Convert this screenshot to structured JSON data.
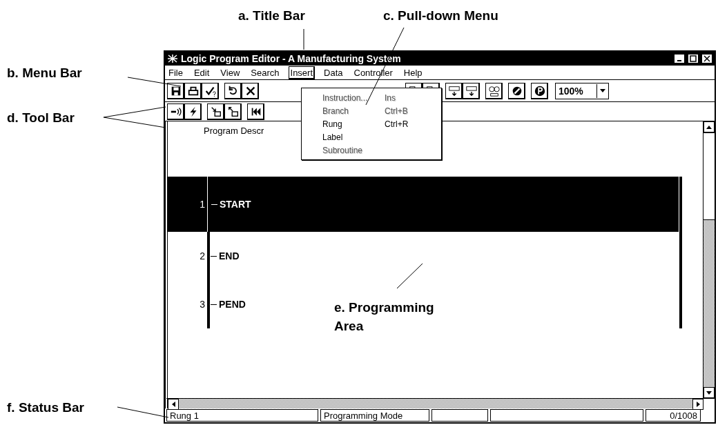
{
  "annotations": [
    {
      "text": "a. Title Bar"
    },
    {
      "text": "c. Pull-down Menu"
    },
    {
      "text": "b. Menu Bar"
    },
    {
      "text": "d. Tool Bar"
    },
    {
      "text": "e. Programming Area"
    },
    {
      "text": "f. Status Bar"
    }
  ],
  "window": {
    "title": "Logic Program Editor - A Manufacturing System"
  },
  "menu_bar": [
    {
      "label": "File",
      "selected": false
    },
    {
      "label": "Edit",
      "selected": false
    },
    {
      "label": "View",
      "selected": false
    },
    {
      "label": "Search",
      "selected": false
    },
    {
      "label": "Insert",
      "selected": true
    },
    {
      "label": "Data",
      "selected": false
    },
    {
      "label": "Controller",
      "selected": false
    },
    {
      "label": "Help",
      "selected": false
    }
  ],
  "menu": {
    "items": [
      {
        "label": "Instruction...",
        "shortcut": "Ins",
        "disabled": true
      },
      {
        "label": "Branch",
        "shortcut": "Ctrl+B",
        "disabled": true
      },
      {
        "label": "Rung",
        "shortcut": "Ctrl+R",
        "disabled": false
      },
      {
        "label": "Label",
        "disabled": false
      },
      {
        "label": "Subroutine",
        "disabled": true
      }
    ]
  },
  "toolbar": {
    "zoom": "100%"
  },
  "program": {
    "description": "Program Descr",
    "rungs": [
      {
        "number": "1",
        "label": "START",
        "selected": true
      },
      {
        "number": "2",
        "label": "END",
        "selected": false
      },
      {
        "number": "3",
        "label": "PEND",
        "selected": false
      }
    ]
  },
  "status_bar": {
    "rung": "Rung 1",
    "mode": "Programming Mode",
    "count": "0/1008"
  }
}
